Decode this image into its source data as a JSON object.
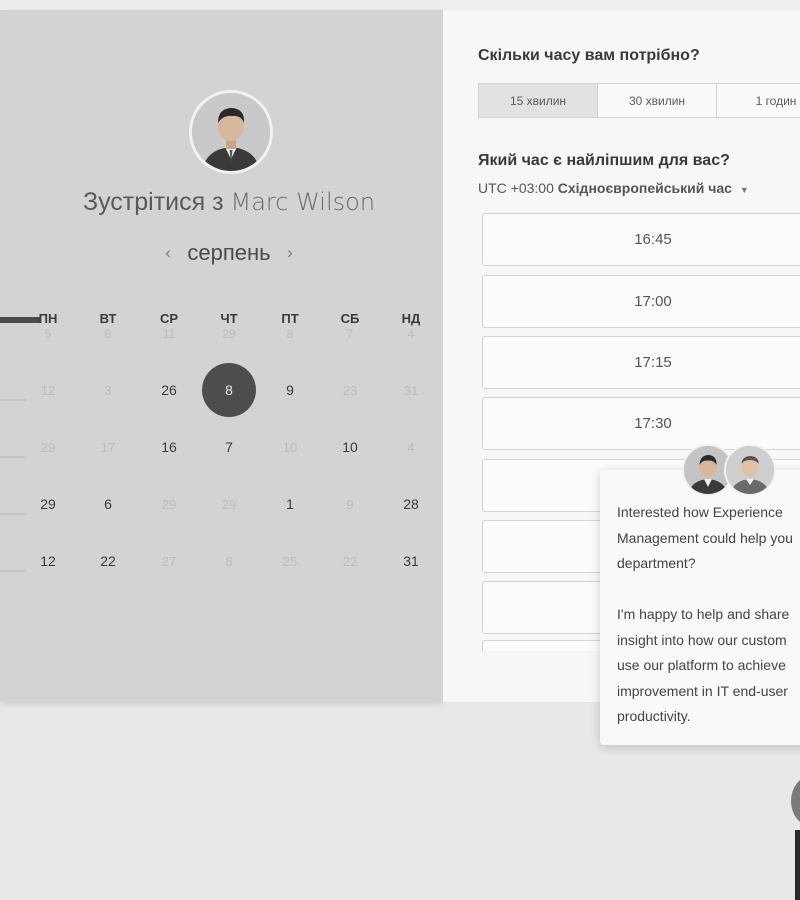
{
  "meeting": {
    "title_prefix": "Зустрітися з",
    "host_name": "Marc Wilson",
    "month": "серпень",
    "prev_icon": "‹",
    "next_icon": "›"
  },
  "calendar": {
    "weekdays": [
      "ПН",
      "ВТ",
      "СР",
      "ЧТ",
      "ПТ",
      "СБ",
      "НД"
    ],
    "weeks": [
      [
        "5",
        "6",
        "11",
        "29",
        "8",
        "7",
        "4"
      ],
      [
        "12",
        "3",
        "26",
        "8",
        "9",
        "23",
        "31"
      ],
      [
        "29",
        "17",
        "16",
        "7",
        "10",
        "10",
        "4"
      ],
      [
        "29",
        "6",
        "29",
        "29",
        "1",
        "9",
        "28"
      ],
      [
        "12",
        "22",
        "27",
        "8",
        "25",
        "22",
        "31"
      ]
    ],
    "selected_day": "8"
  },
  "duration": {
    "question": "Скільки часу вам потрібно?",
    "options": [
      "15 хвилин",
      "30 хвилин",
      "1 годин"
    ],
    "selected_index": 0
  },
  "time_selection": {
    "question": "Який час є найліпшим для вас?",
    "tz_offset": "UTC +03:00",
    "tz_name": "Східноєвропейський час",
    "slots": [
      "16:45",
      "17:00",
      "17:15",
      "17:30",
      "",
      "",
      ""
    ]
  },
  "chat": {
    "message": "Interested how Experience\nManagement could help you\ndepartment?\n\nI'm happy to help and share\ninsight into how our custom\nuse our platform to achieve\nimprovement in IT end-user\nproductivity."
  },
  "colors": {
    "selected_day_bg": "#4d4d4d",
    "left_panel_bg": "#d3d3d3",
    "right_panel_bg": "#f7f7f7"
  },
  "icons": {
    "dropdown": "caret-down-icon",
    "prev_month": "chevron-left-icon",
    "next_month": "chevron-right-icon"
  }
}
